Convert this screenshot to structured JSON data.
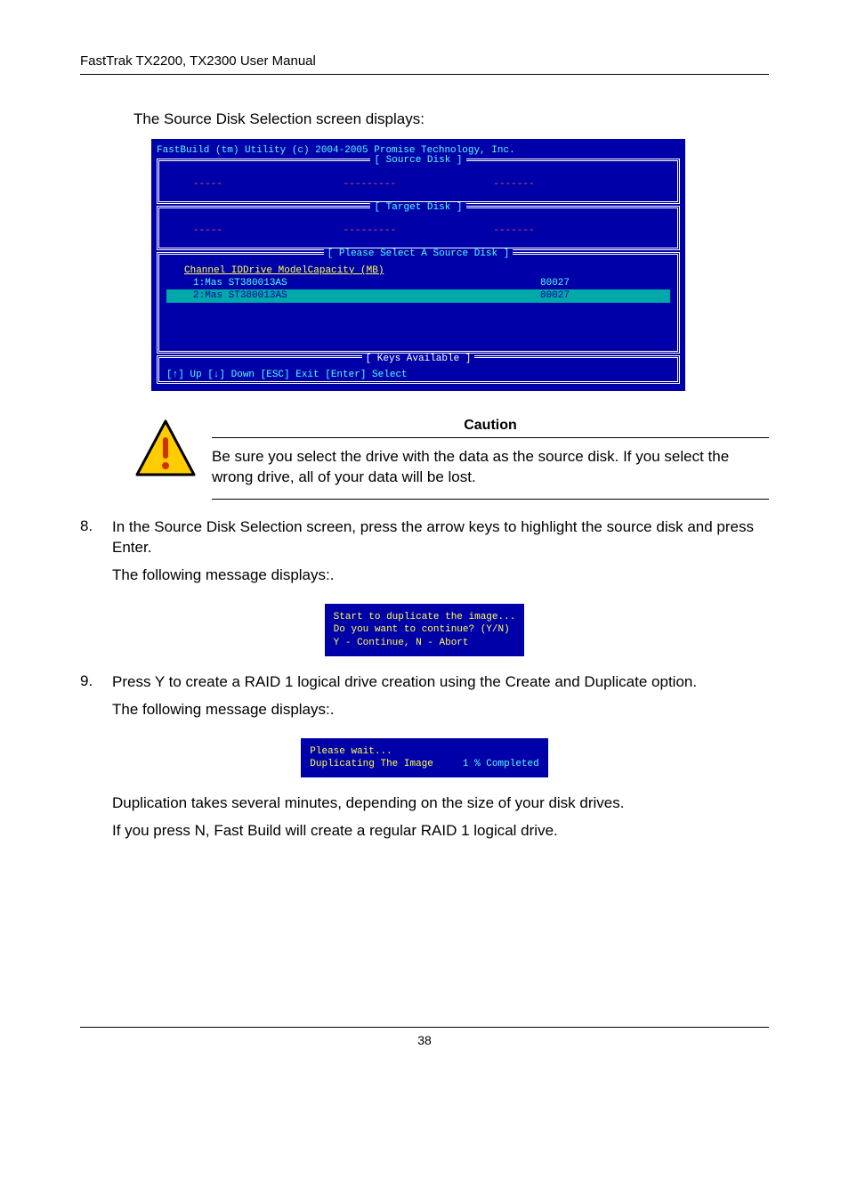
{
  "header": "FastTrak TX2200, TX2300 User Manual",
  "intro": "The Source Disk Selection screen displays:",
  "bios": {
    "title_line": "FastBuild (tm) Utility (c) 2004-2005 Promise Technology, Inc.",
    "source_title": "[ Source Disk ]",
    "target_title": "[ Target Disk ]",
    "select_title": "[ Please Select A Source Disk ]",
    "columns": {
      "c1": "Channel ID",
      "c2": "Drive Model",
      "c3": "Capacity (MB)"
    },
    "rows": [
      {
        "channel": "1:Mas",
        "model": "ST380013AS",
        "capacity": "80027",
        "highlighted": false
      },
      {
        "channel": "2:Mas",
        "model": "ST380013AS",
        "capacity": "80027",
        "highlighted": true
      }
    ],
    "keys_title": "[ Keys Available ]",
    "keys_line": "[↑] Up   [↓] Down  [ESC] Exit    [Enter] Select",
    "dashes": {
      "d1": "-----",
      "d2": "---------",
      "d3": "-------"
    }
  },
  "caution": {
    "title": "Caution",
    "text": "Be sure you select the drive with the data as the source disk. If you select the wrong drive, all of your data will be lost."
  },
  "steps": {
    "s8num": "8.",
    "s8a": "In the Source Disk Selection screen, press the arrow keys to highlight the source disk and press Enter.",
    "s8b": "The following message displays:.",
    "msg1_l1": "Start to duplicate the image...",
    "msg1_l2": "Do you want to continue? (Y/N)",
    "msg1_l3": "Y - Continue, N - Abort",
    "s9num": "9.",
    "s9a": "Press Y to create a RAID 1 logical drive creation using the Create and Duplicate option.",
    "s9b": "The following message displays:.",
    "msg2_l1": "Please wait...",
    "msg2_l2a": "Duplicating The Image",
    "msg2_l2b": "1 % Completed",
    "s9c": "Duplication takes several minutes, depending on the size of your disk drives.",
    "s9d": "If you press N, Fast Build will create a regular RAID 1 logical drive."
  },
  "footer": "38"
}
